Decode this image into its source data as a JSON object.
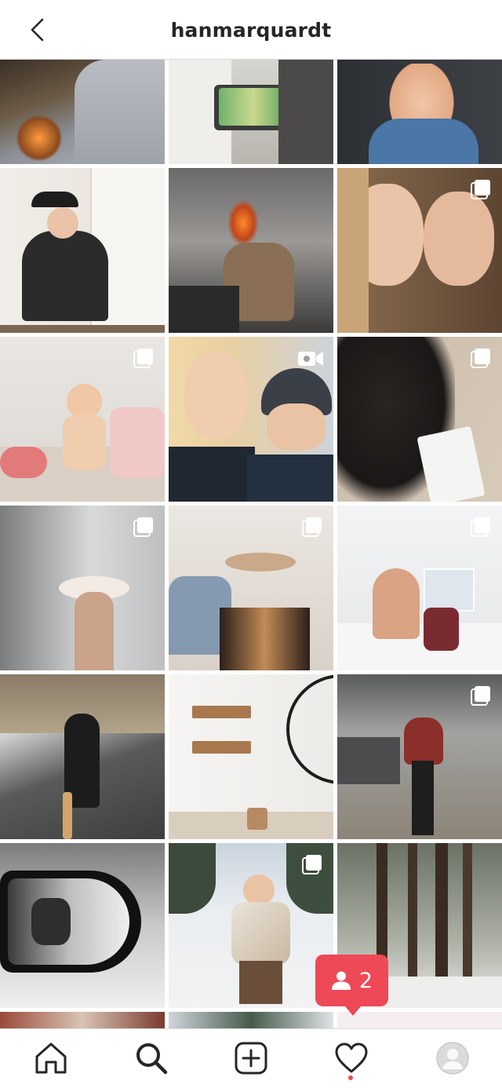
{
  "header": {
    "username": "hanmarquardt",
    "back_icon": "chevron-left-icon"
  },
  "grid": {
    "posts": [
      {
        "badge": "none"
      },
      {
        "badge": "none"
      },
      {
        "badge": "none"
      },
      {
        "badge": "none"
      },
      {
        "badge": "none"
      },
      {
        "badge": "multiple"
      },
      {
        "badge": "multiple"
      },
      {
        "badge": "video"
      },
      {
        "badge": "multiple"
      },
      {
        "badge": "multiple"
      },
      {
        "badge": "multiple"
      },
      {
        "badge": "multiple"
      },
      {
        "badge": "none"
      },
      {
        "badge": "none"
      },
      {
        "badge": "multiple"
      },
      {
        "badge": "none"
      },
      {
        "badge": "multiple"
      },
      {
        "badge": "none"
      },
      {
        "badge": "none"
      },
      {
        "badge": "none"
      },
      {
        "badge": "multiple"
      }
    ]
  },
  "notification": {
    "icon": "person-icon",
    "count": "2",
    "color": "#ed4956"
  },
  "tabbar": {
    "items": [
      "home-icon",
      "search-icon",
      "new-post-icon",
      "activity-heart-icon",
      "profile-avatar"
    ],
    "active_indicator_color": "#ed4956"
  }
}
